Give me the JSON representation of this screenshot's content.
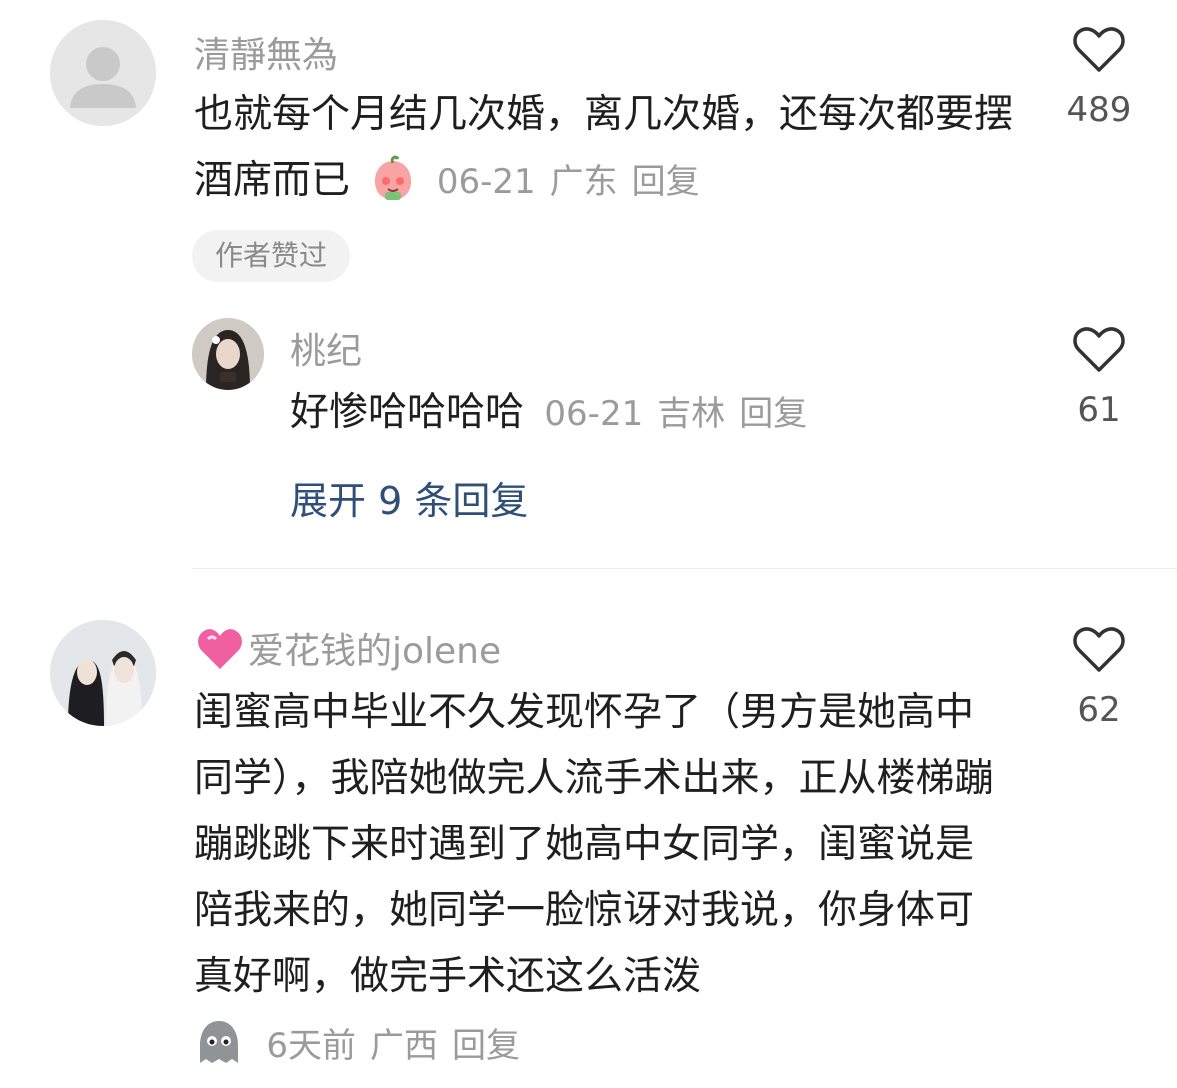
{
  "comments": [
    {
      "username": "清靜無為",
      "text": "也就每个月结几次婚，离几次婚，还每次都要摆酒席而已",
      "date": "06-21",
      "location": "广东",
      "reply_label": "回复",
      "likes": "489",
      "badge": "作者赞过",
      "avatar_icon": "default-user-avatar-icon",
      "emoji_icon": "peach-emoji-icon",
      "replies": [
        {
          "username": "桃纪",
          "text": "好惨哈哈哈哈",
          "date": "06-21",
          "location": "吉林",
          "reply_label": "回复",
          "likes": "61"
        }
      ],
      "expand_label": "展开 9 条回复"
    },
    {
      "username": "爱花钱的jolene",
      "username_prefix_icon": "pink-heart-icon",
      "text": "闺蜜高中毕业不久发现怀孕了（男方是她高中同学），我陪她做完人流手术出来，正从楼梯蹦蹦跳跳下来时遇到了她高中女同学，闺蜜说是陪我来的，她同学一脸惊讶对我说，你身体可真好啊，做完手术还这么活泼",
      "date": "6天前",
      "location": "广西",
      "reply_label": "回复",
      "likes": "62",
      "emoji_icon": "ghost-emoji-icon"
    }
  ],
  "colors": {
    "meta_gray": "#9b9b9b",
    "expand_blue": "#2f4f78",
    "badge_bg": "#f2f2f2",
    "divider": "#ececec"
  }
}
